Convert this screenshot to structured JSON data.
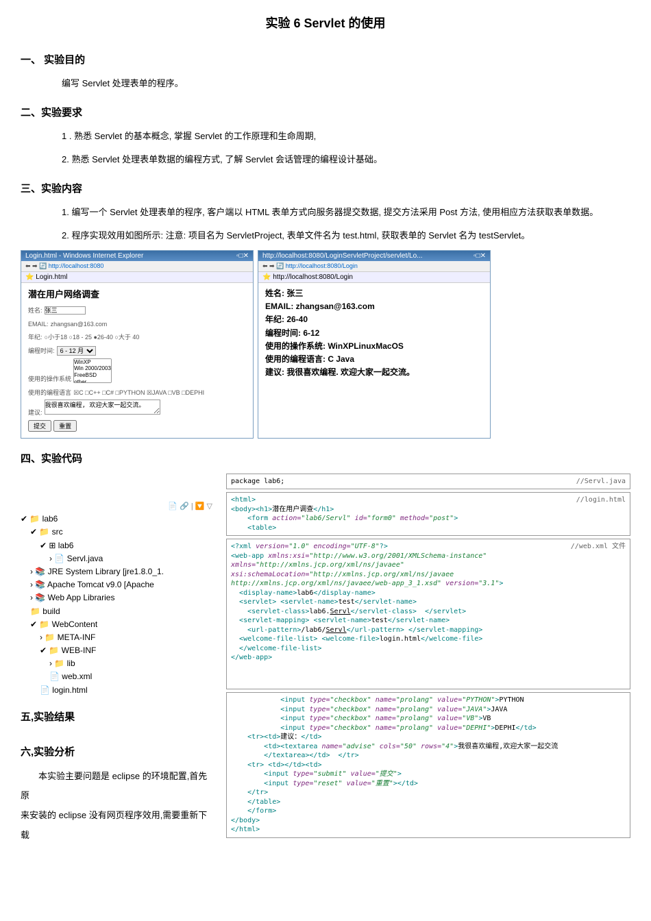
{
  "title": "实验 6 Servlet 的使用",
  "sec1": {
    "heading": "一、 实验目的",
    "p1": "编写 Servlet 处理表单的程序。"
  },
  "sec2": {
    "heading": "二、实验要求",
    "p1": "1 . 熟悉 Servlet 的基本概念, 掌握 Servlet 的工作原理和生命周期,",
    "p2": "2. 熟悉 Servlet 处理表单数据的编程方式, 了解 Servlet 会话管理的编程设计基础。"
  },
  "sec3": {
    "heading": "三、实验内容",
    "p1": "1. 编写一个 Servlet 处理表单的程序, 客户端以 HTML 表单方式向服务器提交数据, 提交方法采用 Post 方法, 使用相应方法获取表单数据。",
    "p2": "2. 程序实现效用如图所示: 注意: 项目名为 ServletProject, 表单文件名为 test.html, 获取表单的 Servlet 名为 testServlet。"
  },
  "browser_left": {
    "title": "Login.html - Windows Internet Explorer",
    "url": "http://localhost:8080",
    "tab": "Login.html",
    "heading": "潜在用户网络调查",
    "name_label": "姓名:",
    "name_value": "张三",
    "email_label": "EMAIL:",
    "email_value": "zhangsan@163.com",
    "age_label": "年纪:",
    "age_opts": "○小于18 ○18 - 25 ●26-40 ○大于 40",
    "time_label": "编程时间:",
    "time_value": "6 - 12 月",
    "os_label": "使用的操作系统",
    "os_opts": "WinXP/Win 2000/2003/FreeBSD/other",
    "lang_label": "使用的编程语言",
    "lang_opts": "☒C □C++ □C# □PYTHON ☒JAVA □VB □DEPHI",
    "advise_label": "建议:",
    "advise_value": "我很喜欢编程, 欢迎大家一起交流。",
    "submit": "提交",
    "reset": "重置"
  },
  "browser_right": {
    "title": "http://localhost:8080/LoginServletProject/servlet/Lo...",
    "url": "http://localhost:8080/Login",
    "tab": "http://localhost:8080/Login",
    "l1": "姓名: 张三",
    "l2": "EMAIL: zhangsan@163.com",
    "l3": "年纪: 26-40",
    "l4": "编程时间: 6-12",
    "l5": "使用的操作系统: WinXPLinuxMacOS",
    "l6": "使用的编程语言: C Java",
    "l7": "建议: 我很喜欢编程. 欢迎大家一起交流。"
  },
  "sec4": {
    "heading": "四、实验代码"
  },
  "tree": {
    "toolbar": "📄 🔗 | 🔽 ▽",
    "root": "lab6",
    "src": "src",
    "pkg": "lab6",
    "java": "Servl.java",
    "jre": "JRE System Library [jre1.8.0_1.",
    "tomcat": "Apache Tomcat v9.0 [Apache",
    "webapp": "Web App Libraries",
    "build": "build",
    "webcontent": "WebContent",
    "meta": "META-INF",
    "webinf": "WEB-INF",
    "lib": "lib",
    "webxml": "web.xml",
    "login": "login.html"
  },
  "code1": {
    "file": "//Servl.java",
    "line": "package lab6;"
  },
  "code2": {
    "file": "//login.html",
    "text": "<html>\n<body><h1>潜在用户调查</h1>\n    <form action=\"lab6/Servl\" id=\"form0\" method=\"post\">\n    <table>"
  },
  "code3": {
    "file": "//web.xml 文件",
    "text": "<?xml version=\"1.0\" encoding=\"UTF-8\"?>\n<web-app xmlns:xsi=\"http://www.w3.org/2001/XMLSchema-instance\"\nxmlns=\"http://xmlns.jcp.org/xml/ns/javaee\"\nxsi:schemaLocation=\"http://xmlns.jcp.org/xml/ns/javaee\nhttp://xmlns.jcp.org/xml/ns/javaee/web-app_3_1.xsd\" version=\"3.1\">\n  <display-name>lab6</display-name>\n  <servlet> <servlet-name>test</servlet-name>\n    <servlet-class>lab6.Servl</servlet-class>  </servlet>\n  <servlet-mapping> <servlet-name>test</servlet-name>\n    <url-pattern>/lab6/Servl</url-pattern> </servlet-mapping>\n  <welcome-file-list> <welcome-file>login.html</welcome-file>\n  </welcome-file-list>\n</web-app>"
  },
  "code4": {
    "text": "            <input type=\"checkbox\" name=\"prolang\" value=\"PYTHON\">PYTHON\n            <input type=\"checkbox\" name=\"prolang\" value=\"JAVA\">JAVA\n            <input type=\"checkbox\" name=\"prolang\" value=\"VB\">VB\n            <input type=\"checkbox\" name=\"prolang\" value=\"DEPHI\">DEPHI</td>\n    <tr><td>建议：</td>\n        <td><textarea name=\"advise\" cols=\"50\" rows=\"4\">我很喜欢编程,欢迎大家一起交流\n        </textarea></td>  </tr>\n    <tr> <td></td><td>\n        <input type=\"submit\" value=\"提交\">\n        <input type=\"reset\" value=\"重置\"></td>\n    </tr>\n    </table>\n    </form>\n</body>\n</html>"
  },
  "sec5": {
    "heading": "五,实验结果"
  },
  "sec6": {
    "heading": "六,实验分析",
    "p1": "本实验主要问题是 eclipse 的环境配置,首先原",
    "p2": "来安装的 eclipse 没有网页程序效用,需要重新下载"
  }
}
